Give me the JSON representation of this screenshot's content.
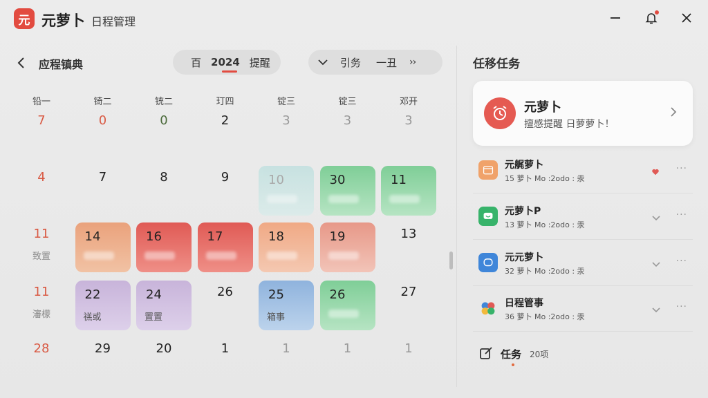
{
  "app": {
    "logo_char": "元",
    "name": "元萝卜",
    "subtitle": "日程管理"
  },
  "calendar": {
    "title": "应程镇典",
    "pill_a": {
      "label": "百",
      "year": "2024",
      "action": "提醒"
    },
    "pill_b": {
      "label1": "引务",
      "label2": "一丑",
      "next": "››"
    },
    "weekdays": [
      "铅一",
      "锜二",
      "铳二",
      "玎四",
      "锭三",
      "锭三",
      "邓开"
    ],
    "rows": [
      [
        {
          "num": "7",
          "tone": "red"
        },
        {
          "num": "0",
          "tone": "red"
        },
        {
          "num": "0",
          "tone": "green"
        },
        {
          "num": "2",
          "tone": "normal"
        },
        {
          "num": "3",
          "tone": "gray"
        },
        {
          "num": "3",
          "tone": "gray"
        },
        {
          "num": "3",
          "tone": "gray"
        }
      ],
      [
        {
          "num": "4",
          "tone": "red"
        },
        {
          "num": "7",
          "tone": "normal"
        },
        {
          "num": "8",
          "tone": "normal"
        },
        {
          "num": "9",
          "tone": "normal"
        },
        {
          "num": "10",
          "tone": "gray",
          "color": "aqua"
        },
        {
          "num": "30",
          "tone": "normal",
          "color": "green"
        },
        {
          "num": "11",
          "tone": "normal",
          "color": "green"
        }
      ],
      [
        {
          "num": "11",
          "tone": "red",
          "sub": "致置"
        },
        {
          "num": "14",
          "tone": "normal",
          "color": "peach"
        },
        {
          "num": "16",
          "tone": "normal",
          "color": "red"
        },
        {
          "num": "17",
          "tone": "normal",
          "color": "red"
        },
        {
          "num": "18",
          "tone": "normal",
          "color": "salmon"
        },
        {
          "num": "19",
          "tone": "normal",
          "color": "pink"
        },
        {
          "num": "13",
          "tone": "normal"
        }
      ],
      [
        {
          "num": "11",
          "tone": "red",
          "sub": "瀋檬"
        },
        {
          "num": "22",
          "tone": "normal",
          "color": "lav",
          "sub": "禚或"
        },
        {
          "num": "24",
          "tone": "normal",
          "color": "lav",
          "sub": "置置"
        },
        {
          "num": "26",
          "tone": "normal"
        },
        {
          "num": "25",
          "tone": "normal",
          "color": "blue",
          "sub": "箱事"
        },
        {
          "num": "26",
          "tone": "normal",
          "color": "green"
        },
        {
          "num": "27",
          "tone": "normal"
        }
      ],
      [
        {
          "num": "28",
          "tone": "red"
        },
        {
          "num": "29",
          "tone": "normal"
        },
        {
          "num": "20",
          "tone": "normal"
        },
        {
          "num": "1",
          "tone": "normal"
        },
        {
          "num": "1",
          "tone": "gray"
        },
        {
          "num": "1",
          "tone": "gray"
        },
        {
          "num": "1",
          "tone": "gray"
        }
      ]
    ]
  },
  "tasks": {
    "title": "任移任务",
    "notice": {
      "title": "元萝卜",
      "text": "擅感提醒 日萝萝卜！"
    },
    "items": [
      {
        "title": "元艉萝卜",
        "meta": "15 萝卜 Mo :2odo : 汞",
        "icon": "calendar-icon",
        "icon_color": "#f0a26a",
        "action": "heart-icon"
      },
      {
        "title": "元萝卜P",
        "meta": "13 萝卜 Mo :2odo : 汞",
        "icon": "chat-icon",
        "icon_color": "#37b36a",
        "action": "chevron-down-icon"
      },
      {
        "title": "元元萝卜",
        "meta": "32 萝卜 Mo :2odo : 汞",
        "icon": "message-icon",
        "icon_color": "#3f86d9",
        "action": "chevron-down-icon"
      },
      {
        "title": "日程管事",
        "meta": "36 萝卜 Mo :2odo : 汞",
        "icon": "multi-color-icon",
        "icon_color": "#e05a55",
        "action": "chevron-down-icon"
      }
    ],
    "more_label": "···",
    "footer": {
      "label": "任务",
      "count": "20项"
    }
  },
  "colors": {
    "accent": "#e24b40",
    "peach": "#eaa27c",
    "red": "#e05a55",
    "salmon": "#f0a985",
    "pink": "#e79888",
    "lav": "#c8b4da",
    "blue": "#8fb3dd",
    "green": "#7fce97",
    "aqua": "#bfe0df"
  }
}
